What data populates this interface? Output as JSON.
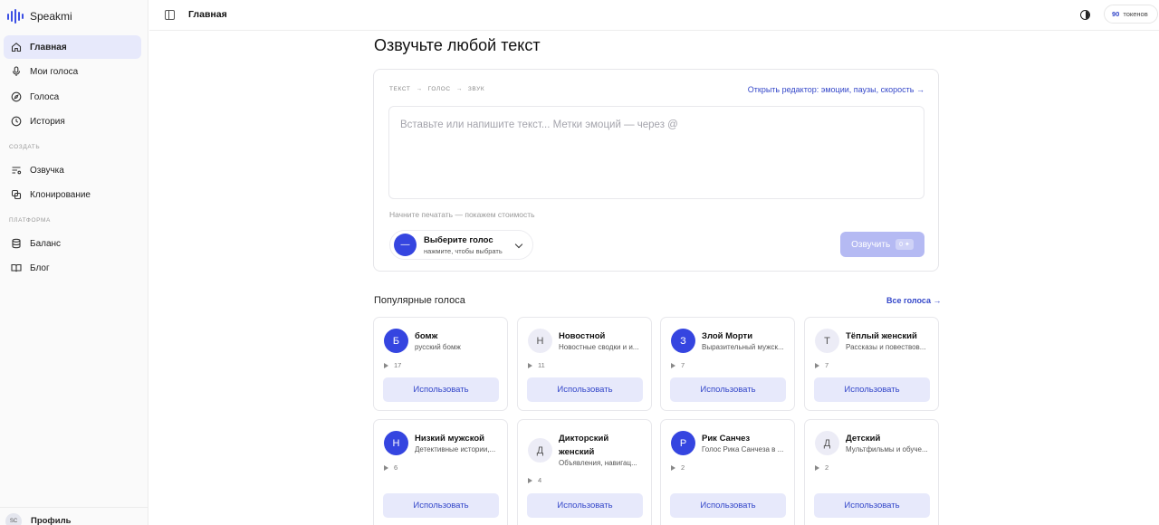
{
  "app": {
    "name": "Speakmi"
  },
  "sidebar": {
    "items": [
      {
        "label": "Главная",
        "icon": "home-icon"
      },
      {
        "label": "Мои голоса",
        "icon": "mic-icon"
      },
      {
        "label": "Голоса",
        "icon": "compass-icon"
      },
      {
        "label": "История",
        "icon": "clock-icon"
      }
    ],
    "section_create": "СОЗДАТЬ",
    "create_items": [
      {
        "label": "Озвучка",
        "icon": "list-icon"
      },
      {
        "label": "Клонирование",
        "icon": "copy-icon"
      }
    ],
    "section_platform": "ПЛАТФОРМА",
    "platform_items": [
      {
        "label": "Баланс",
        "icon": "database-icon"
      },
      {
        "label": "Блог",
        "icon": "book-icon"
      }
    ],
    "profile": {
      "initials": "SC",
      "label": "Профиль"
    }
  },
  "topbar": {
    "crumb": "Главная",
    "tokens_value": "90",
    "tokens_unit": "токенов"
  },
  "main": {
    "title": "Озвучьте любой текст",
    "editor": {
      "steps": [
        "ТЕКСТ",
        "→",
        "ГОЛОС",
        "→",
        "ЗВУК"
      ],
      "open_editor": "Открыть редактор: эмоции, паузы, скорость →",
      "placeholder": "Вставьте или напишите текст... Метки эмоций — через @",
      "cost_hint": "Начните печатать — покажем стоимость",
      "voice_select_main": "Выберите голос",
      "voice_select_sub": "нажмите, чтобы выбрать",
      "voice_dot": "—",
      "speak_label": "Озвучить",
      "speak_cost": "0 ✦"
    },
    "popular_title": "Популярные голоса",
    "all_voices": "Все голоса →",
    "use_label": "Использовать",
    "voices": [
      {
        "initial": "Б",
        "name": "бомж",
        "desc": "русский бомж",
        "plays": "17",
        "style": "solid"
      },
      {
        "initial": "Н",
        "name": "Новостной",
        "desc": "Новостные сводки и и...",
        "plays": "11",
        "style": "soft"
      },
      {
        "initial": "З",
        "name": "Злой Морти",
        "desc": "Выразительный мужск...",
        "plays": "7",
        "style": "solid"
      },
      {
        "initial": "Т",
        "name": "Тёплый женский",
        "desc": "Рассказы и повествов...",
        "plays": "7",
        "style": "soft"
      },
      {
        "initial": "Н",
        "name": "Низкий мужской",
        "desc": "Детективные истории,...",
        "plays": "6",
        "style": "solid"
      },
      {
        "initial": "Д",
        "name": "Дикторский женский",
        "desc": "Объявления, навигац...",
        "plays": "4",
        "style": "soft"
      },
      {
        "initial": "Р",
        "name": "Рик Санчез",
        "desc": "Голос Рика Санчеза в ...",
        "plays": "2",
        "style": "solid"
      },
      {
        "initial": "Д",
        "name": "Детский",
        "desc": "Мультфильмы и обуче...",
        "plays": "2",
        "style": "soft"
      }
    ]
  },
  "colors": {
    "accent": "#3545e0",
    "accent_soft": "#e7e9fb",
    "link": "#3447c9"
  }
}
